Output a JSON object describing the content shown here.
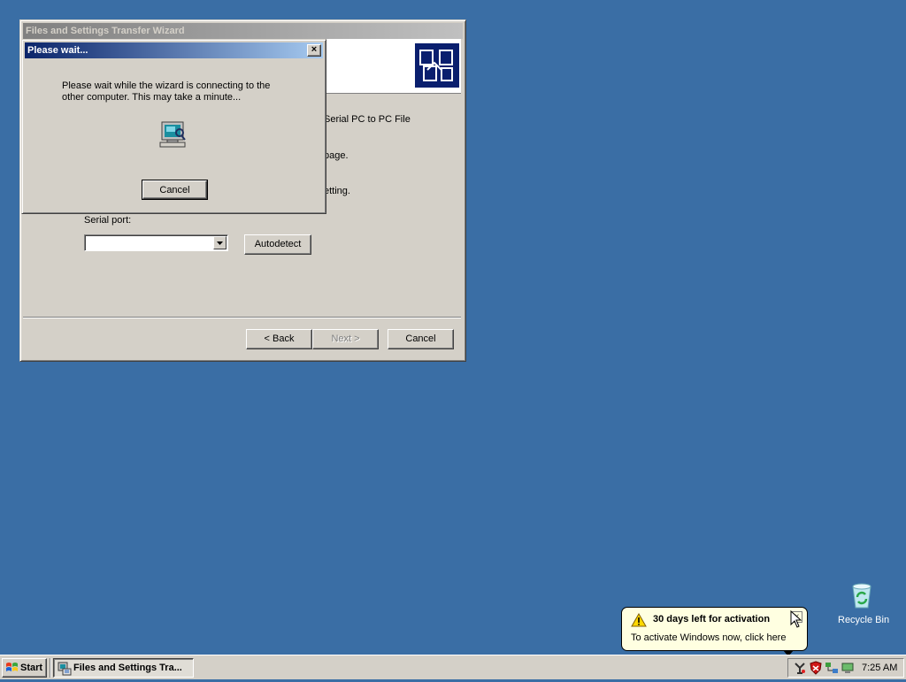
{
  "wizard": {
    "title": "Files and Settings Transfer Wizard",
    "text_line1": "Serial PC to PC File",
    "text_line2": "page.",
    "text_line3": "etting.",
    "serial_port_label": "Serial port:",
    "serial_port_value": "",
    "autodetect_label": "Autodetect",
    "back_label": "< Back",
    "next_label": "Next >",
    "cancel_label": "Cancel"
  },
  "dialog": {
    "title": "Please wait...",
    "close_glyph": "×",
    "message_line1": "Please wait while the wizard is connecting to the",
    "message_line2": "other computer. This may take a minute...",
    "cancel_label": "Cancel"
  },
  "desktop": {
    "recycle_bin_label": "Recycle Bin"
  },
  "balloon": {
    "title": "30 days left for activation",
    "body": "To activate Windows now, click here",
    "close_glyph": "×"
  },
  "taskbar": {
    "start_label": "Start",
    "task_label": "Files and Settings Tra...",
    "clock": "7:25 AM"
  },
  "colors": {
    "desktop": "#3a6ea5",
    "window_face": "#d4d0c8",
    "active_title": "#0a246a",
    "balloon": "#ffffe1"
  }
}
